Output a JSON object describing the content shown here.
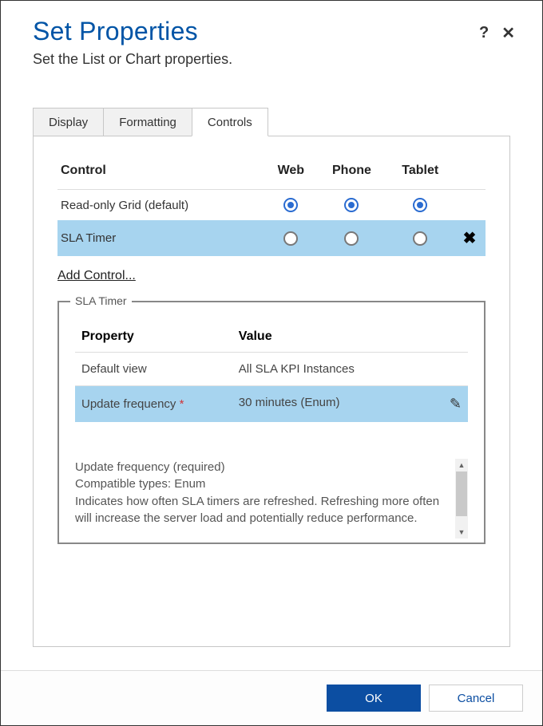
{
  "header": {
    "title": "Set Properties",
    "subtitle": "Set the List or Chart properties."
  },
  "tabs": {
    "items": [
      {
        "label": "Display"
      },
      {
        "label": "Formatting"
      },
      {
        "label": "Controls"
      }
    ]
  },
  "controls_table": {
    "headers": {
      "control": "Control",
      "web": "Web",
      "phone": "Phone",
      "tablet": "Tablet"
    },
    "rows": [
      {
        "name": "Read-only Grid (default)"
      },
      {
        "name": "SLA Timer"
      }
    ]
  },
  "add_control": "Add Control...",
  "fieldset": {
    "legend": "SLA Timer",
    "headers": {
      "property": "Property",
      "value": "Value"
    },
    "rows": [
      {
        "property": "Default view",
        "value": "All SLA KPI Instances"
      },
      {
        "property": "Update frequency",
        "value": "30 minutes (Enum)"
      }
    ]
  },
  "description": {
    "line1": "Update frequency (required)",
    "line2": "Compatible types: Enum",
    "line3": "Indicates how often SLA timers are refreshed. Refreshing more often will increase the server load and potentially reduce performance."
  },
  "footer": {
    "ok": "OK",
    "cancel": "Cancel"
  }
}
